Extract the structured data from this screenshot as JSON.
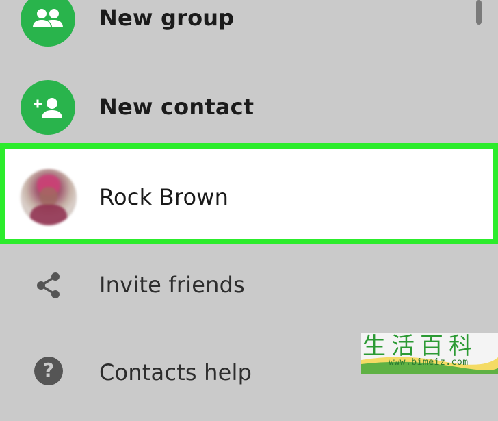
{
  "contacts_menu": {
    "items": [
      {
        "label": "New group",
        "icon": "group-icon"
      },
      {
        "label": "New contact",
        "icon": "add-person-icon"
      },
      {
        "label": "Rock Brown",
        "icon": "avatar"
      },
      {
        "label": "Invite friends",
        "icon": "share-icon"
      },
      {
        "label": "Contacts help",
        "icon": "help-icon"
      }
    ],
    "highlighted_item": "Rock Brown"
  },
  "colors": {
    "accent_green": "#29b44c",
    "highlight_border": "#2cec2c",
    "background": "#cacaca"
  },
  "watermark": {
    "chars": "生活百科",
    "url": "www.bimeiz.com"
  }
}
